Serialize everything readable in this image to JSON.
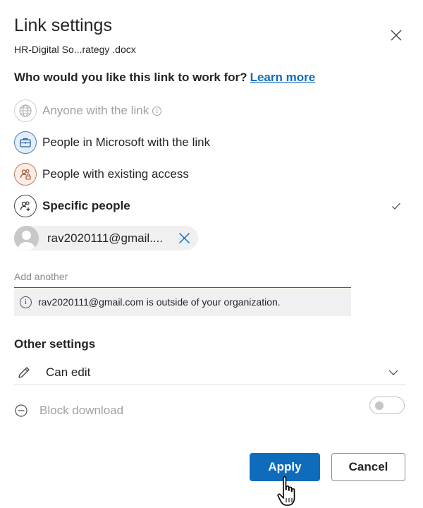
{
  "dialog": {
    "title": "Link settings",
    "file_name": "HR-Digital So...rategy .docx"
  },
  "question": {
    "text": "Who would you like this link to work for?",
    "learn_more": "Learn more"
  },
  "options": [
    {
      "label": "Anyone with the link",
      "icon": "globe-icon",
      "disabled": true
    },
    {
      "label": "People in Microsoft with the link",
      "icon": "briefcase-icon",
      "disabled": false
    },
    {
      "label": "People with existing access",
      "icon": "people-lock-icon",
      "disabled": false
    },
    {
      "label": "Specific people",
      "icon": "people-add-icon",
      "selected": true
    }
  ],
  "recipient": {
    "email": "rav2020111@gmail...."
  },
  "add_input": {
    "placeholder": "Add another"
  },
  "notice": {
    "text": "rav2020111@gmail.com is outside of your organization."
  },
  "other_settings": {
    "heading": "Other settings",
    "permission": "Can edit",
    "block_download": "Block download",
    "block_download_on": false
  },
  "buttons": {
    "apply": "Apply",
    "cancel": "Cancel"
  },
  "colors": {
    "accent": "#0f6cbd",
    "disabled_text": "#a0a0a0"
  }
}
